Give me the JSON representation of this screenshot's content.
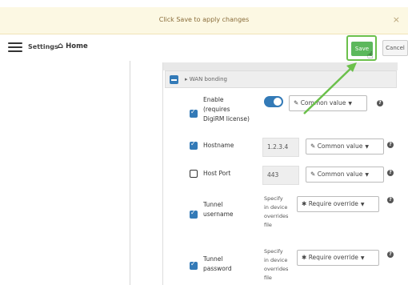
{
  "banner": {
    "text": "Click Save to apply changes",
    "close": "×"
  },
  "header": {
    "settings_label": "Settings",
    "home_label": "Home",
    "save_label": "Save",
    "cancel_label": "Cancel"
  },
  "section": {
    "title": "WAN bonding"
  },
  "fields": {
    "enable": {
      "label_lines": [
        "Enable",
        "(requires",
        "DigiRM license)"
      ],
      "select": "Common value"
    },
    "hostname": {
      "label": "Hostname",
      "value": "1.2.3.4",
      "select": "Common value"
    },
    "host_port": {
      "label": "Host Port",
      "value": "443",
      "select": "Common value"
    },
    "tunnel_username": {
      "label_lines": [
        "Tunnel",
        "username"
      ],
      "note_lines": [
        "Specify",
        "in device",
        "overrides",
        "file"
      ],
      "select": "Require override"
    },
    "tunnel_password": {
      "label_lines": [
        "Tunnel",
        "password"
      ],
      "note_lines": [
        "Specify",
        "in device",
        "overrides",
        "file"
      ],
      "select": "Require override"
    }
  },
  "icons": {
    "help": "?",
    "edit": "✎",
    "asterisk": "✱",
    "caret": "▼",
    "home": "🏠",
    "check": "✓"
  },
  "colors": {
    "primary": "#337ab7",
    "save": "#5cb85c",
    "arrow": "#6bc04b",
    "banner_bg": "#fcf8e3"
  }
}
